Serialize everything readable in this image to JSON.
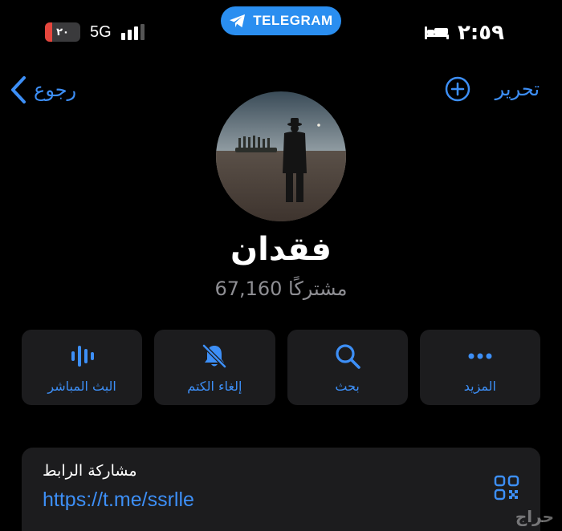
{
  "status_bar": {
    "battery_text": "٢٠",
    "battery_level": 0.2,
    "network": "5G",
    "signal_bars_active": 3,
    "time": "٢:٥٩",
    "icons": [
      "battery-charging-icon",
      "signal-icon",
      "sleep-focus-icon"
    ]
  },
  "pill": {
    "label": "TELEGRAM",
    "icon": "telegram-plane-icon"
  },
  "nav": {
    "back_label": "رجوع",
    "edit_label": "تحرير",
    "icons": [
      "chevron-left-icon",
      "add-circle-icon"
    ]
  },
  "channel": {
    "name": "فقدان",
    "subscribers": "67,160 مشتركًا"
  },
  "actions": [
    {
      "label": "المزيد",
      "icon": "more-dots-icon"
    },
    {
      "label": "بحث",
      "icon": "search-icon"
    },
    {
      "label": "إلغاء الكتم",
      "icon": "bell-muted-icon"
    },
    {
      "label": "البث المباشر",
      "icon": "live-stream-icon"
    }
  ],
  "link_card": {
    "title": "مشاركة الرابط",
    "url": "https://t.me/ssrlle",
    "icon": "qr-code-icon"
  },
  "watermark": "حراج",
  "colors": {
    "accent": "#3d8ff7",
    "pill": "#2a8ef0",
    "card": "#1c1c1e",
    "secondary_text": "#8e8e93",
    "battery_red": "#e5463d"
  }
}
